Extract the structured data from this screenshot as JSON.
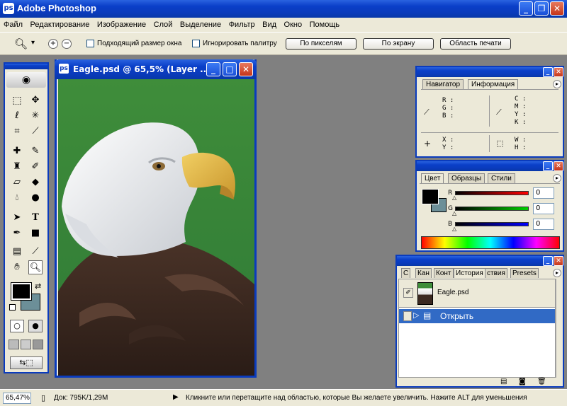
{
  "app": {
    "title": "Adobe Photoshop"
  },
  "menu": {
    "items": [
      "Файл",
      "Редактирование",
      "Изображение",
      "Слой",
      "Выделение",
      "Фильтр",
      "Вид",
      "Окно",
      "Помощь"
    ]
  },
  "options": {
    "resize_window_label": "Подходящий размер окна",
    "ignore_palettes_label": "Игнорировать палитру",
    "actual_pixels_label": "По пикселям",
    "fit_screen_label": "По экрану",
    "print_size_label": "Область печати",
    "zoom_dropdown_value": "▾"
  },
  "document": {
    "title": "Eagle.psd @ 65,5% (Layer ..."
  },
  "navigator_panel": {
    "tab_navigator": "Навигатор",
    "tab_info": "Информация",
    "rgb": [
      "R :",
      "G :",
      "B :"
    ],
    "cmyk": [
      "C :",
      "M :",
      "Y :",
      "K :"
    ],
    "xy": [
      "X :",
      "Y :"
    ],
    "wh": [
      "W :",
      "H :"
    ]
  },
  "color_panel": {
    "tab_color": "Цвет",
    "tab_swatches": "Образцы",
    "tab_styles": "Стили",
    "sliders": [
      {
        "label": "R",
        "value": "0",
        "color": "#ff0000"
      },
      {
        "label": "G",
        "value": "0",
        "color": "#00d000"
      },
      {
        "label": "B",
        "value": "0",
        "color": "#0000ff"
      }
    ]
  },
  "history_panel": {
    "tabs": [
      "С",
      "Кан",
      "Конт",
      "История",
      "ствия",
      "Presets"
    ],
    "snapshot_name": "Eagle.psd",
    "step_name": "Открыть"
  },
  "status": {
    "zoom": "65,47%",
    "doc_info": "Док: 795K/1,29M",
    "hint": "Кликните или перетащите над областью, которые Вы желаете увеличить. Нажите ALT для уменьшения"
  },
  "colors": {
    "foreground": "#000000",
    "background": "#6c8f98",
    "titlebar": "#0a3bbd",
    "selection": "#316ac5"
  }
}
